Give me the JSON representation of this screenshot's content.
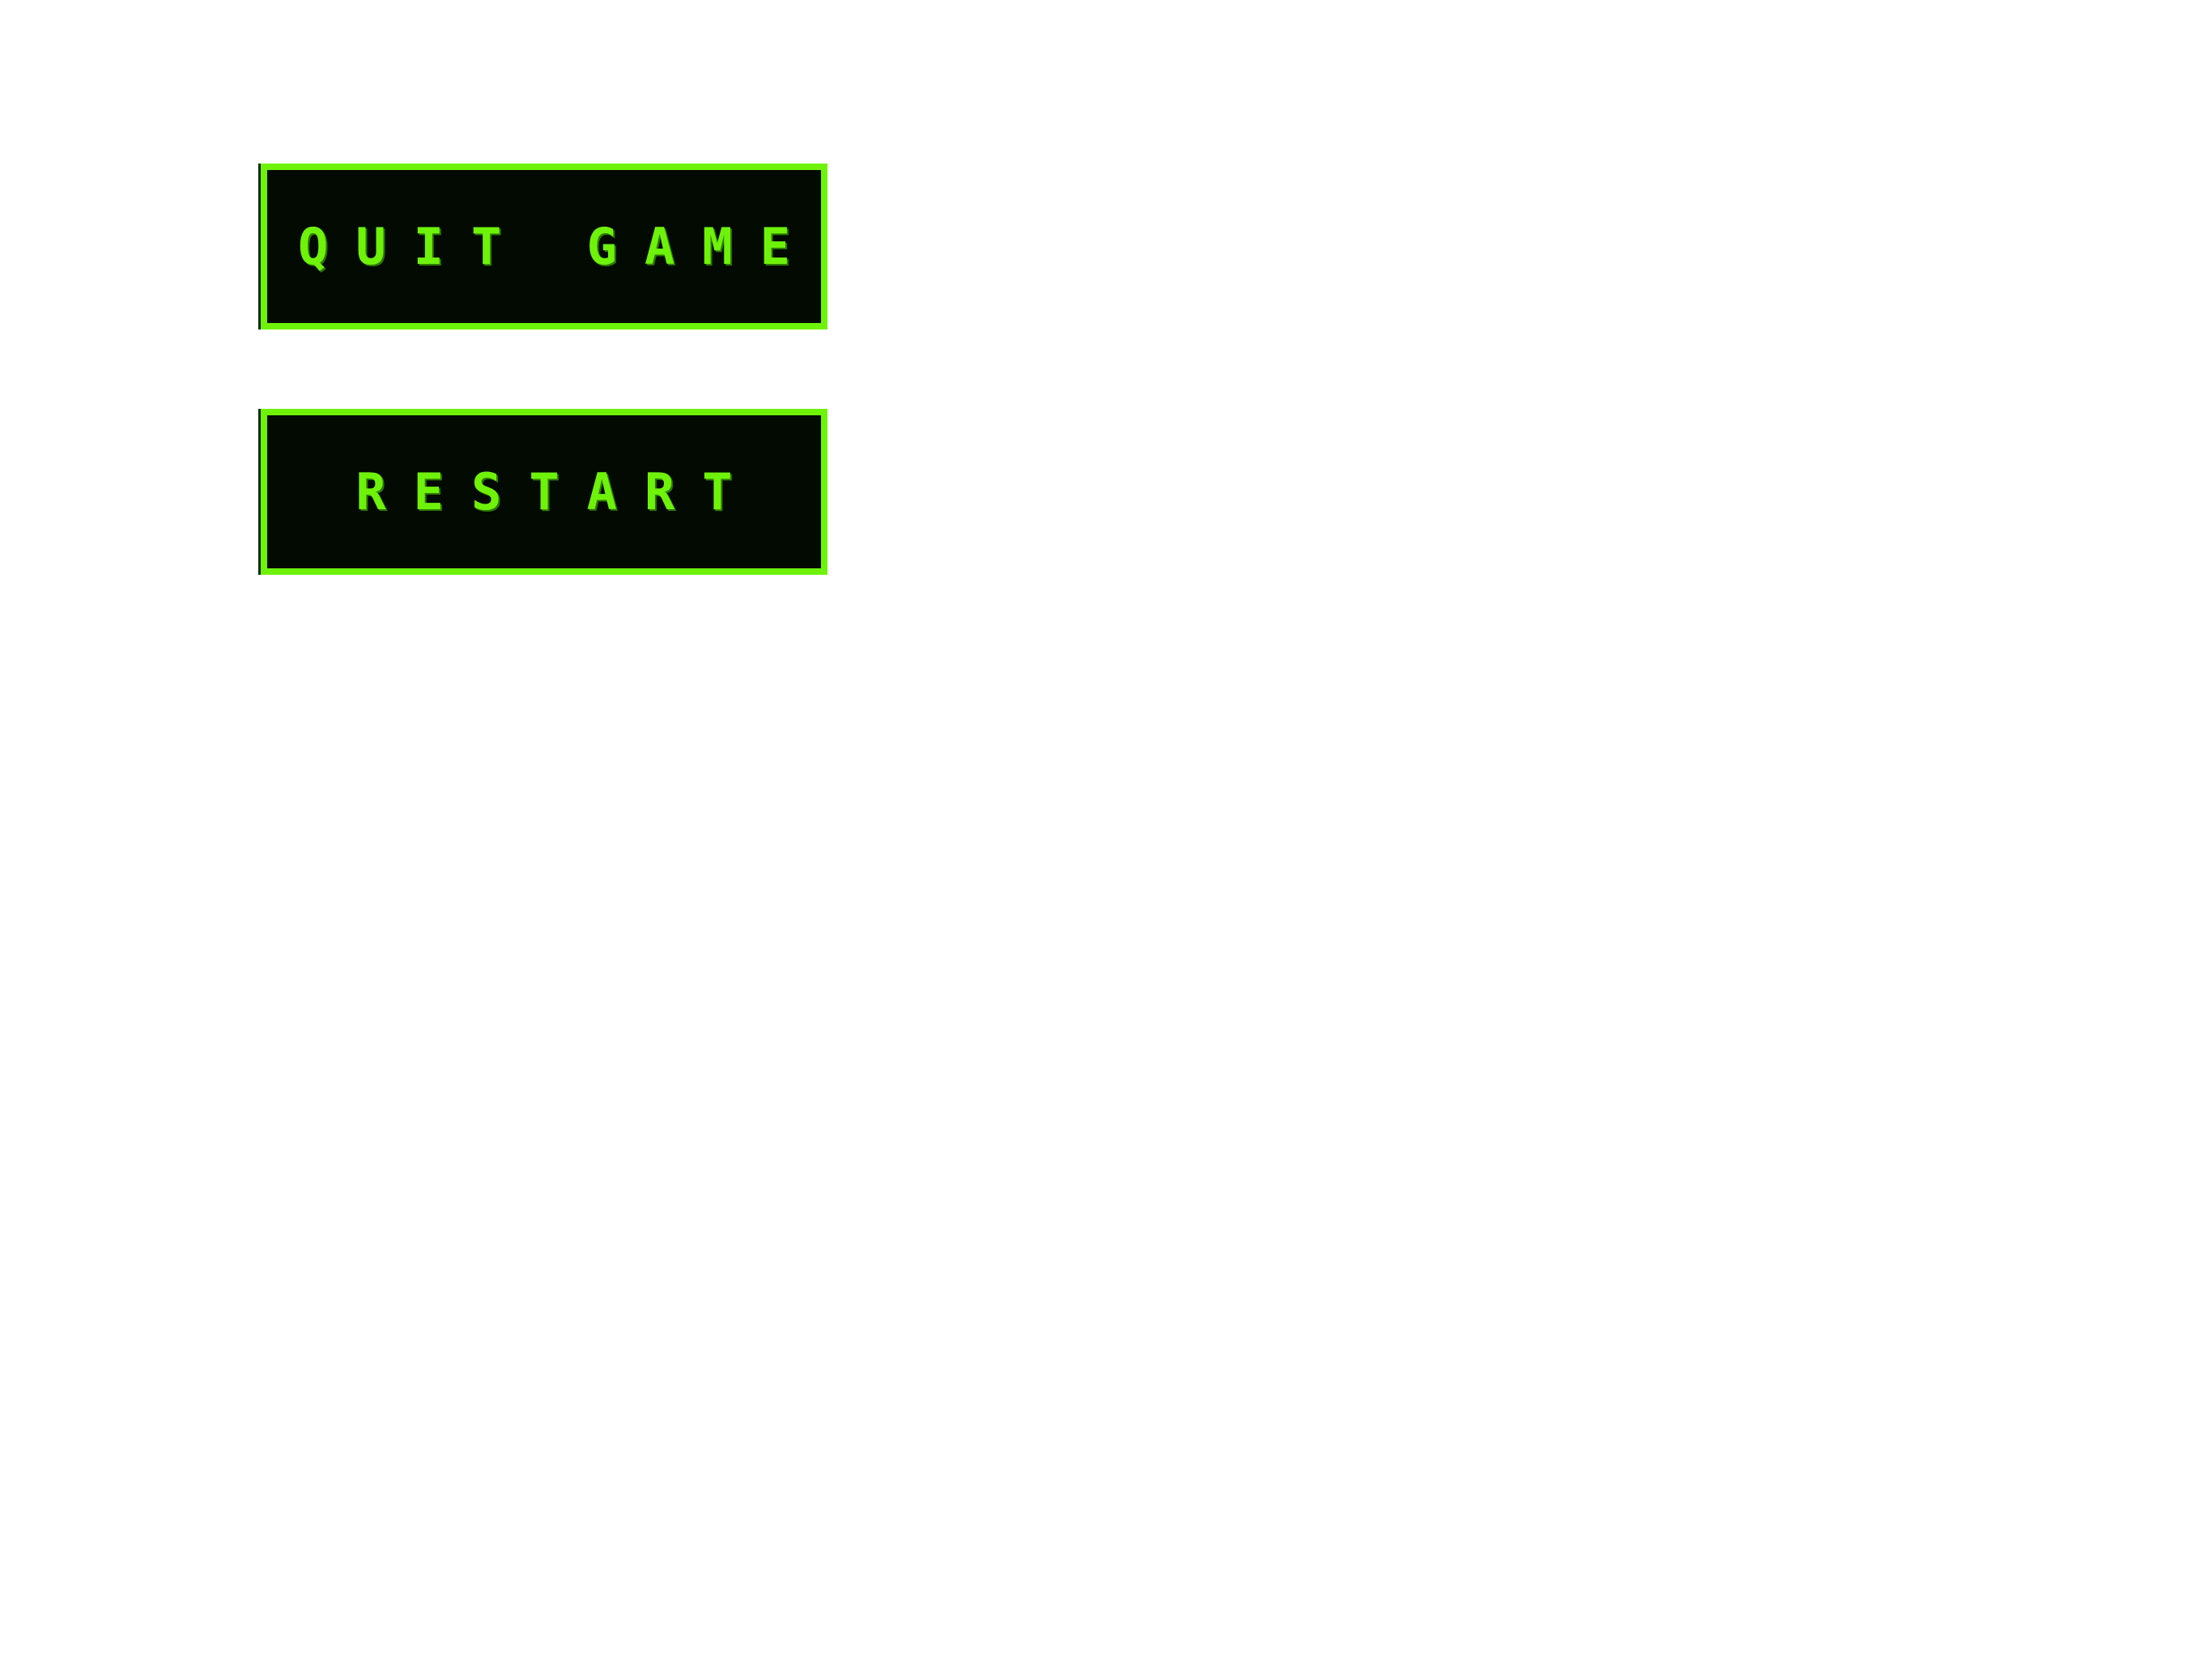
{
  "menu": {
    "buttons": [
      {
        "label": "QUIT GAME"
      },
      {
        "label": "RESTART"
      }
    ]
  },
  "colors": {
    "accent": "#6ff20a",
    "button_background": "#020a02",
    "page_background": "#ffffff"
  }
}
